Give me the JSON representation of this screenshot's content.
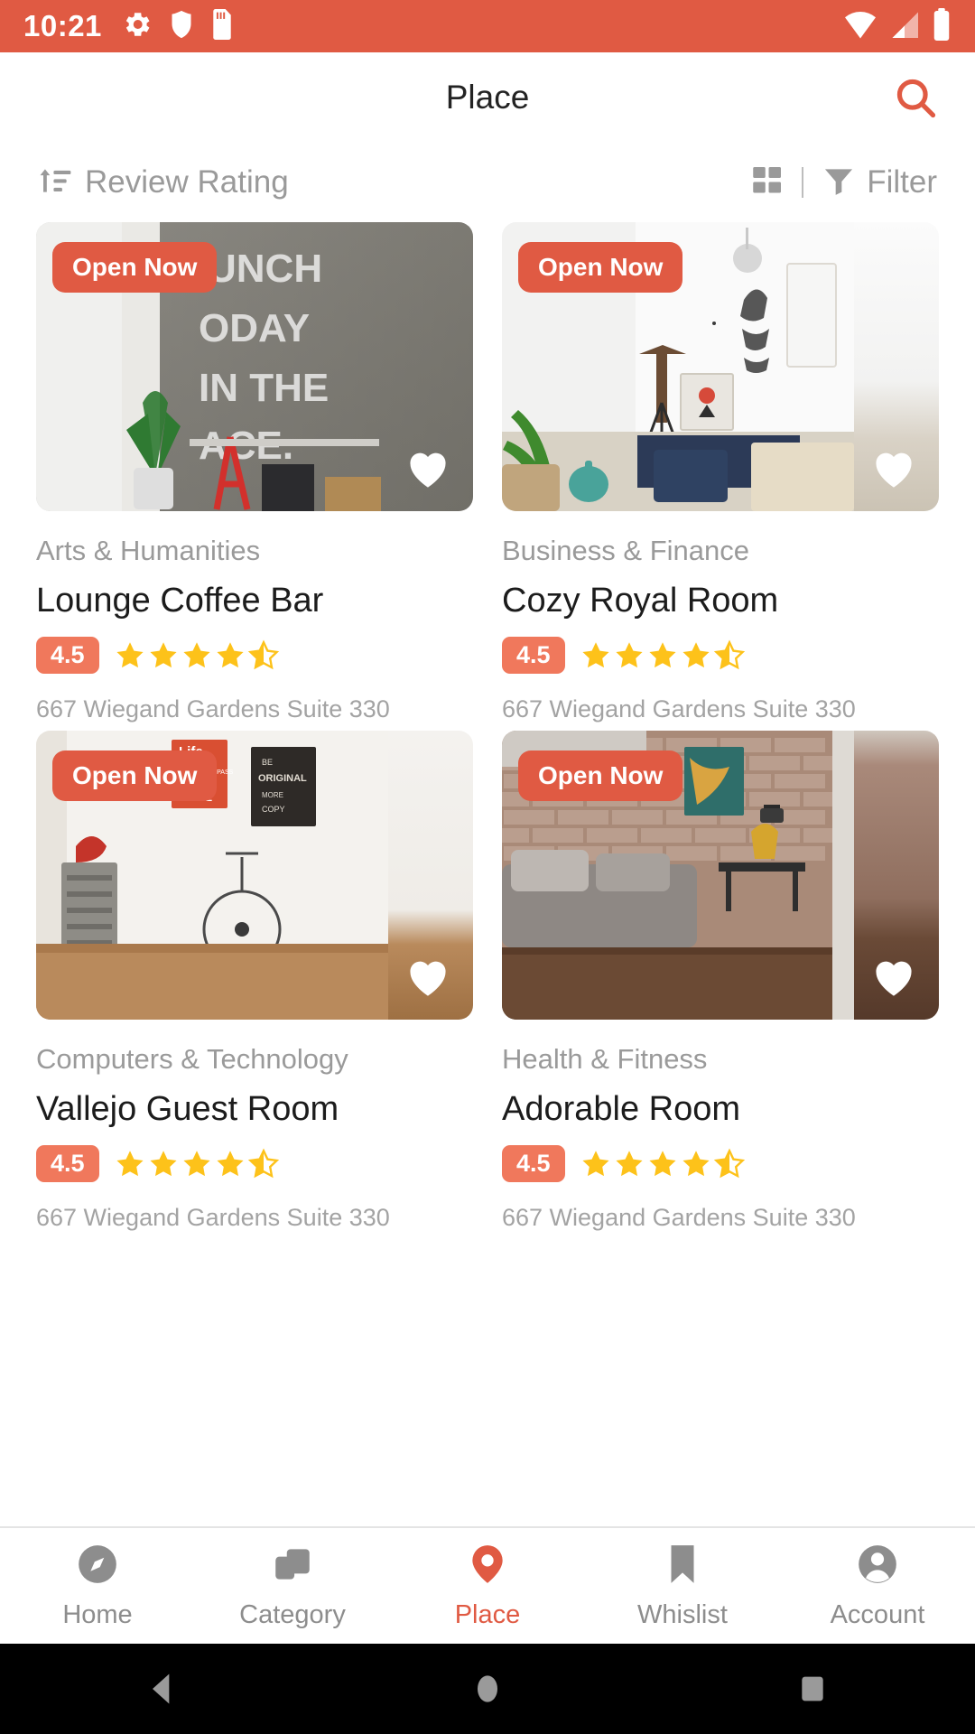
{
  "status_bar": {
    "time": "10:21",
    "icons": [
      "gear-icon",
      "shield-icon",
      "sd-card-icon"
    ],
    "right_icons": [
      "wifi-icon",
      "signal-icon",
      "battery-icon"
    ],
    "background_color": "#e05a43"
  },
  "app_bar": {
    "title": "Place",
    "search_icon": "search-icon",
    "accent_color": "#e05a43"
  },
  "sort_bar": {
    "sort_icon": "sort-ascending-icon",
    "sort_label": "Review Rating",
    "grid_icon": "grid-view-icon",
    "filter_icon": "funnel-filter-icon",
    "filter_label": "Filter"
  },
  "cards": [
    {
      "badge": "Open Now",
      "favorite_icon": "heart-outline-icon",
      "category": "Arts & Humanities",
      "title": "Lounge Coffee Bar",
      "rating": "4.5",
      "stars": 4.5,
      "address": "667 Wiegand Gardens Suite 330",
      "photo_class": "ph1"
    },
    {
      "badge": "Open Now",
      "favorite_icon": "heart-outline-icon",
      "category": "Business & Finance",
      "title": "Cozy Royal Room",
      "rating": "4.5",
      "stars": 4.5,
      "address": "667 Wiegand Gardens Suite 330",
      "photo_class": "ph2"
    },
    {
      "badge": "Open Now",
      "favorite_icon": "heart-outline-icon",
      "category": "Computers & Technology",
      "title": "Vallejo Guest Room",
      "rating": "4.5",
      "stars": 4.5,
      "address": "667 Wiegand Gardens Suite 330",
      "photo_class": "ph3"
    },
    {
      "badge": "Open Now",
      "favorite_icon": "heart-outline-icon",
      "category": "Health & Fitness",
      "title": "Adorable Room",
      "rating": "4.5",
      "stars": 4.5,
      "address": "667 Wiegand Gardens Suite 330",
      "photo_class": "ph4"
    }
  ],
  "bottom_nav": {
    "active_color": "#e05a43",
    "inactive_color": "#8d8d8d",
    "items": [
      {
        "label": "Home",
        "icon": "compass-icon",
        "active": false
      },
      {
        "label": "Category",
        "icon": "layers-icon",
        "active": false
      },
      {
        "label": "Place",
        "icon": "map-pin-icon",
        "active": true
      },
      {
        "label": "Whislist",
        "icon": "bookmark-icon",
        "active": false
      },
      {
        "label": "Account",
        "icon": "account-circle-icon",
        "active": false
      }
    ]
  },
  "system_nav": {
    "buttons": [
      "back-triangle-icon",
      "home-circle-icon",
      "recents-square-icon"
    ]
  },
  "colors": {
    "accent": "#e05a43",
    "badge": "#f0785c",
    "star": "#fdc21a",
    "muted_text": "#9a9a9a"
  }
}
